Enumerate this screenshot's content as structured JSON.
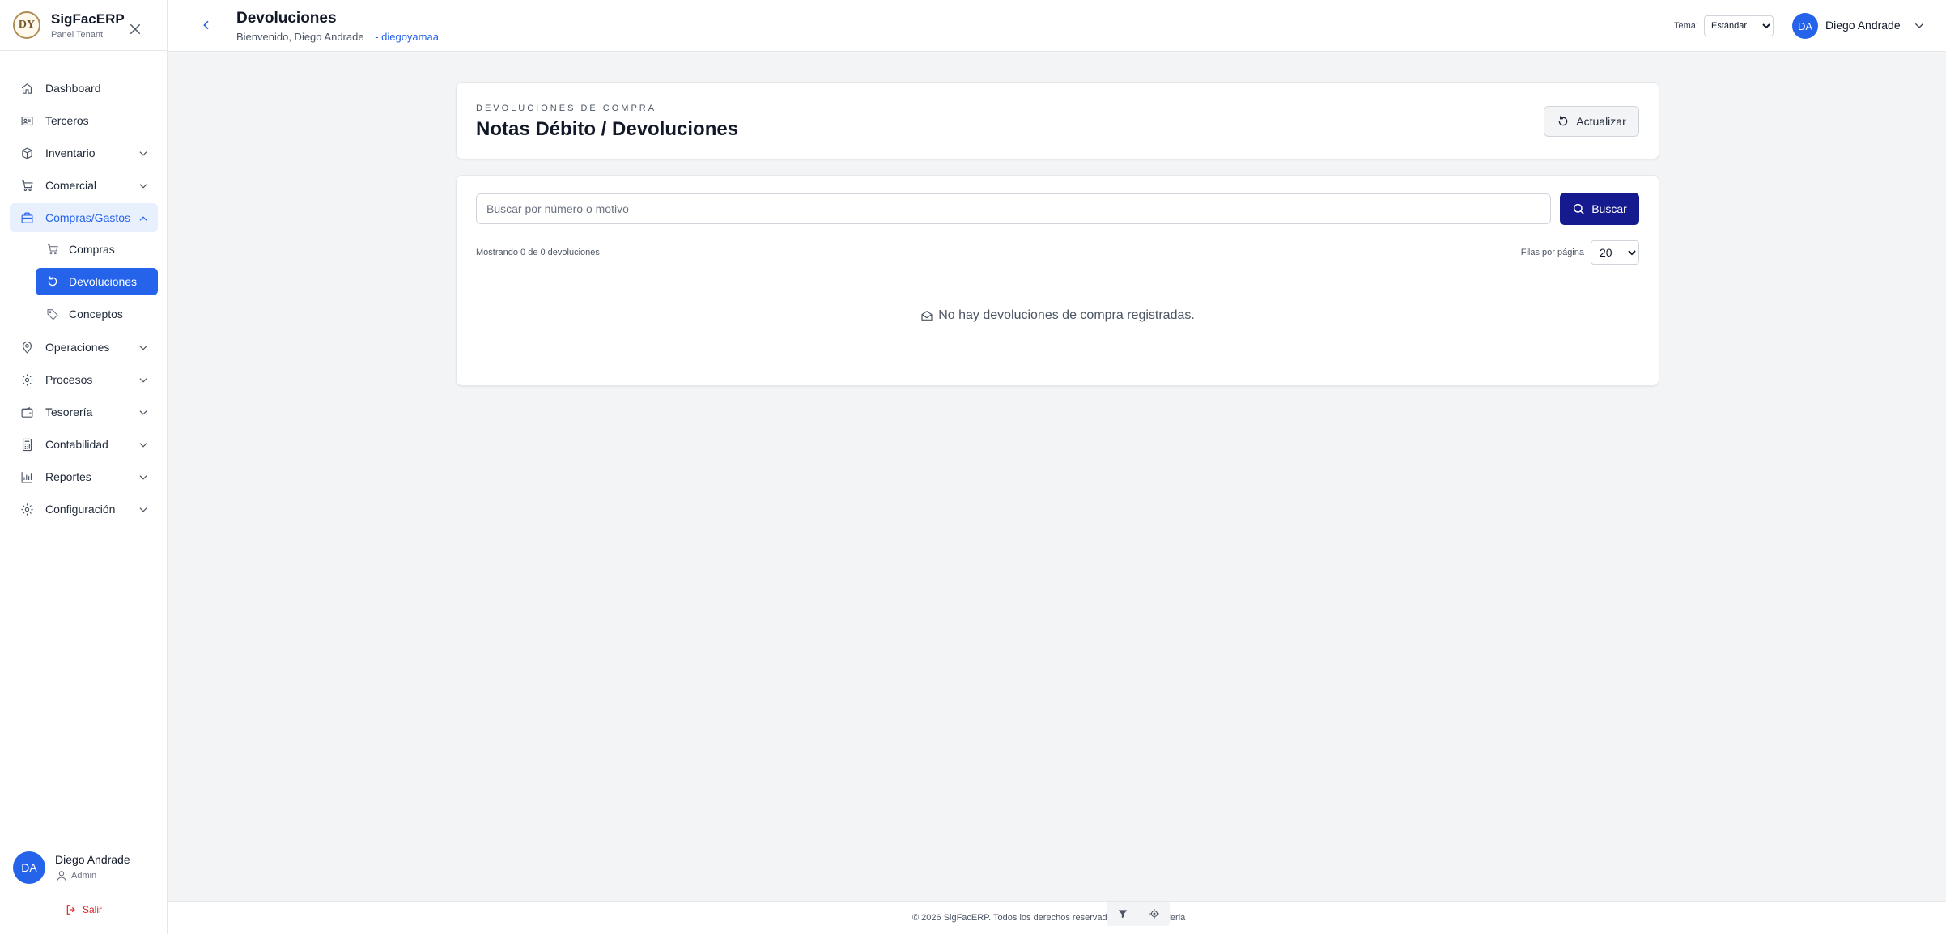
{
  "brand": {
    "name": "SigFacERP",
    "subtitle": "Panel Tenant",
    "logo_text": "DY"
  },
  "sidebar": {
    "items": [
      {
        "label": "Dashboard",
        "icon": "home-icon"
      },
      {
        "label": "Terceros",
        "icon": "id-card-icon"
      },
      {
        "label": "Inventario",
        "icon": "box-icon"
      },
      {
        "label": "Comercial",
        "icon": "cart-icon"
      },
      {
        "label": "Compras/Gastos",
        "icon": "bag-icon"
      },
      {
        "label": "Operaciones",
        "icon": "location-pin-icon"
      },
      {
        "label": "Procesos",
        "icon": "gear-icon"
      },
      {
        "label": "Tesorería",
        "icon": "wallet-icon"
      },
      {
        "label": "Contabilidad",
        "icon": "calculator-icon"
      },
      {
        "label": "Reportes",
        "icon": "bar-chart-icon"
      },
      {
        "label": "Configuración",
        "icon": "gear-icon"
      }
    ],
    "subitems": [
      {
        "label": "Compras",
        "icon": "cart-icon"
      },
      {
        "label": "Devoluciones",
        "icon": "rotate-icon"
      },
      {
        "label": "Conceptos",
        "icon": "tag-icon"
      }
    ],
    "user": {
      "initials": "DA",
      "name": "Diego Andrade",
      "role": "Admin",
      "logout": "Salir"
    }
  },
  "header": {
    "title": "Devoluciones",
    "welcome": "Bienvenido, Diego Andrade",
    "username": "- diegoyamaa",
    "theme_label": "Tema:",
    "theme_value": "Estándar",
    "user_initials": "DA",
    "user_name": "Diego Andrade"
  },
  "main": {
    "eyebrow": "DEVOLUCIONES DE COMPRA",
    "title": "Notas Débito / Devoluciones",
    "refresh_label": "Actualizar",
    "search_placeholder": "Buscar por número o motivo",
    "search_button": "Buscar",
    "showing_text": "Mostrando 0 de 0 devoluciones",
    "rows_label": "Filas por página",
    "rows_value": "20",
    "empty_text": "No hay devoluciones de compra registradas."
  },
  "footer": {
    "text": "© 2026 SigFacERP. Todos los derechos reservados. · ItdyaIngenieria"
  },
  "colors": {
    "accent": "#2563eb",
    "primary_button": "#151a8f"
  }
}
